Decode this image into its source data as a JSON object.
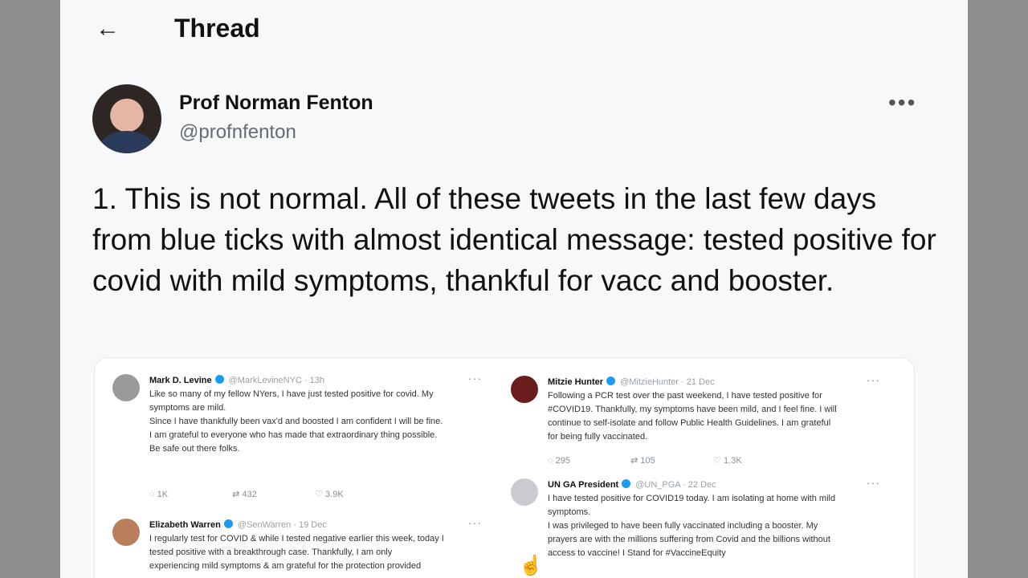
{
  "header": {
    "back_icon": "arrow-left-icon",
    "title": "Thread"
  },
  "author": {
    "name": "Prof Norman Fenton",
    "handle": "@profnfenton",
    "more_icon": "more-horizontal-icon"
  },
  "tweet": {
    "text": "1. This is not normal. All of these tweets in the last few days from blue ticks with almost identical message: tested positive for covid with mild symptoms, thankful for vacc and booster."
  },
  "embedded": {
    "tweets": [
      {
        "name": "Mark D. Levine",
        "meta": "@MarkLevineNYC · 13h",
        "lines": [
          "Like so many of my fellow NYers, I have just tested positive for covid. My",
          "symptoms are mild.",
          "",
          "Since I have thankfully been vax'd and boosted I am confident I will be fine.",
          "I am grateful to everyone who has made that extraordinary thing possible.",
          "",
          "Be safe out there folks."
        ],
        "reply": "1K",
        "retweet": "432",
        "like": "3.9K"
      },
      {
        "name": "Mitzie Hunter",
        "meta": "@MitzieHunter · 21 Dec",
        "lines": [
          "Following a PCR test over the past weekend, I have tested positive for",
          "#COVID19. Thankfully, my symptoms have been mild, and I feel fine. I will",
          "continue to self-isolate and follow Public Health Guidelines. I am grateful",
          "for being fully vaccinated."
        ],
        "reply": "295",
        "retweet": "105",
        "like": "1.3K"
      },
      {
        "name": "UN GA President",
        "meta": "@UN_PGA · 22 Dec",
        "lines": [
          "I have tested positive for COVID19 today. I am isolating at home with mild",
          "symptoms.",
          "",
          "I was privileged to have been fully vaccinated including a booster. My",
          "prayers are with the millions suffering from Covid and the billions without",
          "access to vaccine! I Stand for #VaccineEquity"
        ]
      },
      {
        "name": "Elizabeth Warren",
        "meta": "@SenWarren · 19 Dec",
        "lines": [
          "I regularly test for COVID & while I tested negative earlier this week, today I",
          "tested positive with a breakthrough case. Thankfully, I am only",
          "experiencing mild symptoms & am grateful for the protection provided"
        ]
      }
    ]
  }
}
